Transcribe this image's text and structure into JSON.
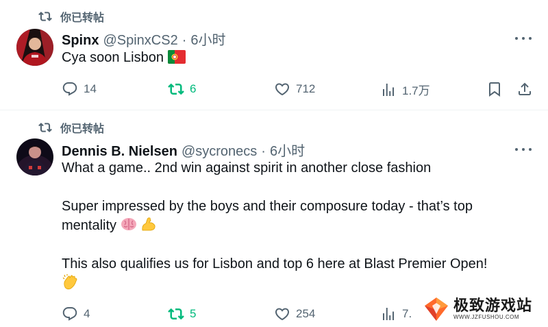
{
  "tweets": [
    {
      "retweet_label": "你已转帖",
      "author_name": "Spinx",
      "handle": "@SpinxCS2",
      "separator": "·",
      "time": "6小时",
      "body_line1": "Cya soon Lisbon",
      "stats": {
        "replies": "14",
        "retweets": "6",
        "likes": "712",
        "views": "1.7万"
      }
    },
    {
      "retweet_label": "你已转帖",
      "author_name": "Dennis B. Nielsen",
      "handle": "@sycronecs",
      "separator": "·",
      "time": "6小时",
      "body_line1": "What a game.. 2nd win against spirit in another close fashion",
      "body_line2": "Super impressed by the boys and their composure today - that’s top",
      "body_line3": "mentality",
      "body_line4": "This also qualifies us for Lisbon and top 6 here at Blast Premier Open!",
      "stats": {
        "replies": "4",
        "retweets": "5",
        "likes": "254",
        "views": "7."
      }
    }
  ],
  "watermark": {
    "title": "极致游戏站",
    "subtitle": "WWW.JZFUSHOU.COM"
  },
  "colors": {
    "text": "#0f1419",
    "muted": "#536471",
    "retweet_green": "#00ba7c",
    "divider": "#eff3f4"
  }
}
